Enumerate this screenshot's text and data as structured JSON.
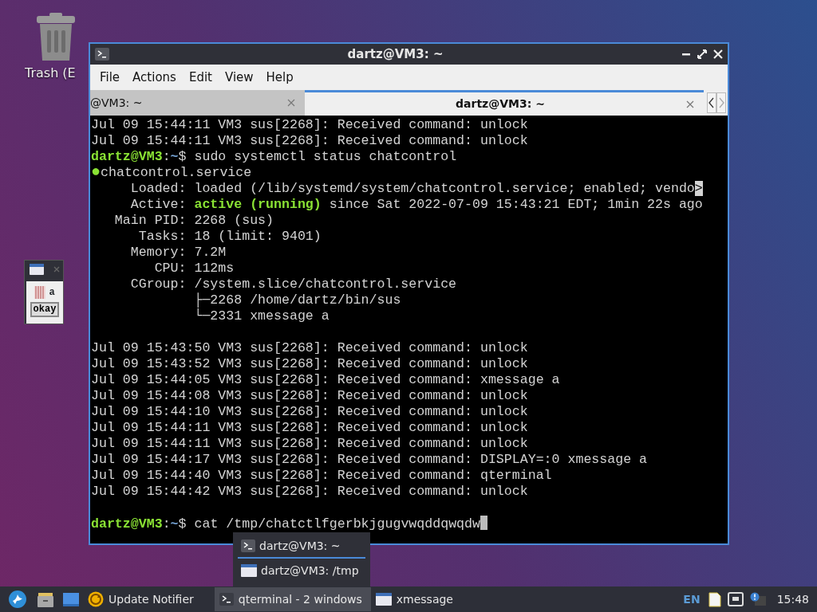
{
  "desktop_icons": [
    {
      "label": "Trash (E"
    }
  ],
  "terminal_window": {
    "title": "dartz@VM3: ~",
    "menu": [
      "File",
      "Actions",
      "Edit",
      "View",
      "Help"
    ],
    "tabs": [
      {
        "label": "@VM3: ~",
        "selected": false
      },
      {
        "label": "dartz@VM3: ~",
        "selected": true
      }
    ],
    "cursor": true,
    "lines": [
      {
        "kind": "text",
        "segments": [
          {
            "kind": "plain",
            "text": "Jul 09 15:44:11 VM3 sus[2268]: Received command: unlock"
          }
        ]
      },
      {
        "kind": "text",
        "segments": [
          {
            "kind": "plain",
            "text": "Jul 09 15:44:11 VM3 sus[2268]: Received command: unlock"
          }
        ]
      },
      {
        "kind": "text",
        "segments": [
          {
            "kind": "user",
            "text": "dartz@VM3"
          },
          {
            "kind": "plain",
            "text": ":"
          },
          {
            "kind": "path",
            "text": "~"
          },
          {
            "kind": "plain",
            "text": "$ sudo systemctl status chatcontrol"
          }
        ]
      },
      {
        "kind": "text",
        "segments": [
          {
            "kind": "dot",
            "text": "●"
          },
          {
            "kind": "plain",
            "text": "chatcontrol.service"
          }
        ]
      },
      {
        "kind": "text",
        "segments": [
          {
            "kind": "plain",
            "text": "     Loaded: loaded (/lib/systemd/system/chatcontrol.service; enabled; vendo"
          },
          {
            "kind": "reverse",
            "text": ">"
          }
        ]
      },
      {
        "kind": "text",
        "segments": [
          {
            "kind": "plain",
            "text": "     Active: "
          },
          {
            "kind": "active",
            "text": "active (running)"
          },
          {
            "kind": "plain",
            "text": " since Sat 2022-07-09 15:43:21 EDT; 1min 22s ago"
          }
        ]
      },
      {
        "kind": "text",
        "segments": [
          {
            "kind": "plain",
            "text": "   Main PID: 2268 (sus)"
          }
        ]
      },
      {
        "kind": "text",
        "segments": [
          {
            "kind": "plain",
            "text": "      Tasks: 18 (limit: 9401)"
          }
        ]
      },
      {
        "kind": "text",
        "segments": [
          {
            "kind": "plain",
            "text": "     Memory: 7.2M"
          }
        ]
      },
      {
        "kind": "text",
        "segments": [
          {
            "kind": "plain",
            "text": "        CPU: 112ms"
          }
        ]
      },
      {
        "kind": "text",
        "segments": [
          {
            "kind": "plain",
            "text": "     CGroup: /system.slice/chatcontrol.service"
          }
        ]
      },
      {
        "kind": "text",
        "segments": [
          {
            "kind": "plain",
            "text": "             ├─2268 /home/dartz/bin/sus"
          }
        ]
      },
      {
        "kind": "text",
        "segments": [
          {
            "kind": "plain",
            "text": "             └─2331 xmessage a"
          }
        ]
      },
      {
        "kind": "blank"
      },
      {
        "kind": "text",
        "segments": [
          {
            "kind": "plain",
            "text": "Jul 09 15:43:50 VM3 sus[2268]: Received command: unlock"
          }
        ]
      },
      {
        "kind": "text",
        "segments": [
          {
            "kind": "plain",
            "text": "Jul 09 15:43:52 VM3 sus[2268]: Received command: unlock"
          }
        ]
      },
      {
        "kind": "text",
        "segments": [
          {
            "kind": "plain",
            "text": "Jul 09 15:44:05 VM3 sus[2268]: Received command: xmessage a"
          }
        ]
      },
      {
        "kind": "text",
        "segments": [
          {
            "kind": "plain",
            "text": "Jul 09 15:44:08 VM3 sus[2268]: Received command: unlock"
          }
        ]
      },
      {
        "kind": "text",
        "segments": [
          {
            "kind": "plain",
            "text": "Jul 09 15:44:10 VM3 sus[2268]: Received command: unlock"
          }
        ]
      },
      {
        "kind": "text",
        "segments": [
          {
            "kind": "plain",
            "text": "Jul 09 15:44:11 VM3 sus[2268]: Received command: unlock"
          }
        ]
      },
      {
        "kind": "text",
        "segments": [
          {
            "kind": "plain",
            "text": "Jul 09 15:44:11 VM3 sus[2268]: Received command: unlock"
          }
        ]
      },
      {
        "kind": "text",
        "segments": [
          {
            "kind": "plain",
            "text": "Jul 09 15:44:17 VM3 sus[2268]: Received command: DISPLAY=:0 xmessage a"
          }
        ]
      },
      {
        "kind": "text",
        "segments": [
          {
            "kind": "plain",
            "text": "Jul 09 15:44:40 VM3 sus[2268]: Received command: qterminal"
          }
        ]
      },
      {
        "kind": "text",
        "segments": [
          {
            "kind": "plain",
            "text": "Jul 09 15:44:42 VM3 sus[2268]: Received command: unlock"
          }
        ]
      },
      {
        "kind": "blank"
      },
      {
        "kind": "text",
        "segments": [
          {
            "kind": "user",
            "text": "dartz@VM3"
          },
          {
            "kind": "plain",
            "text": ":"
          },
          {
            "kind": "path",
            "text": "~"
          },
          {
            "kind": "plain",
            "text": "$ cat /tmp/chatctlfgerbkjgugvwqddqwqdw"
          }
        ]
      }
    ]
  },
  "xmessage_window": {
    "message": "a",
    "button": "okay"
  },
  "window_menu": {
    "items": [
      {
        "label": "dartz@VM3: ~",
        "kind": "terminal",
        "selected": true
      },
      {
        "label": "dartz@VM3: /tmp",
        "kind": "window",
        "selected": false
      }
    ]
  },
  "taskbar": {
    "quick_launch": [
      {
        "label": "Update Notifier"
      }
    ],
    "tasks": [
      {
        "label": "qterminal - 2 windows",
        "kind": "terminal",
        "selected": true
      },
      {
        "label": "xmessage",
        "kind": "window",
        "selected": false
      }
    ],
    "keyboard_layout": "EN",
    "clock": "15:48"
  }
}
